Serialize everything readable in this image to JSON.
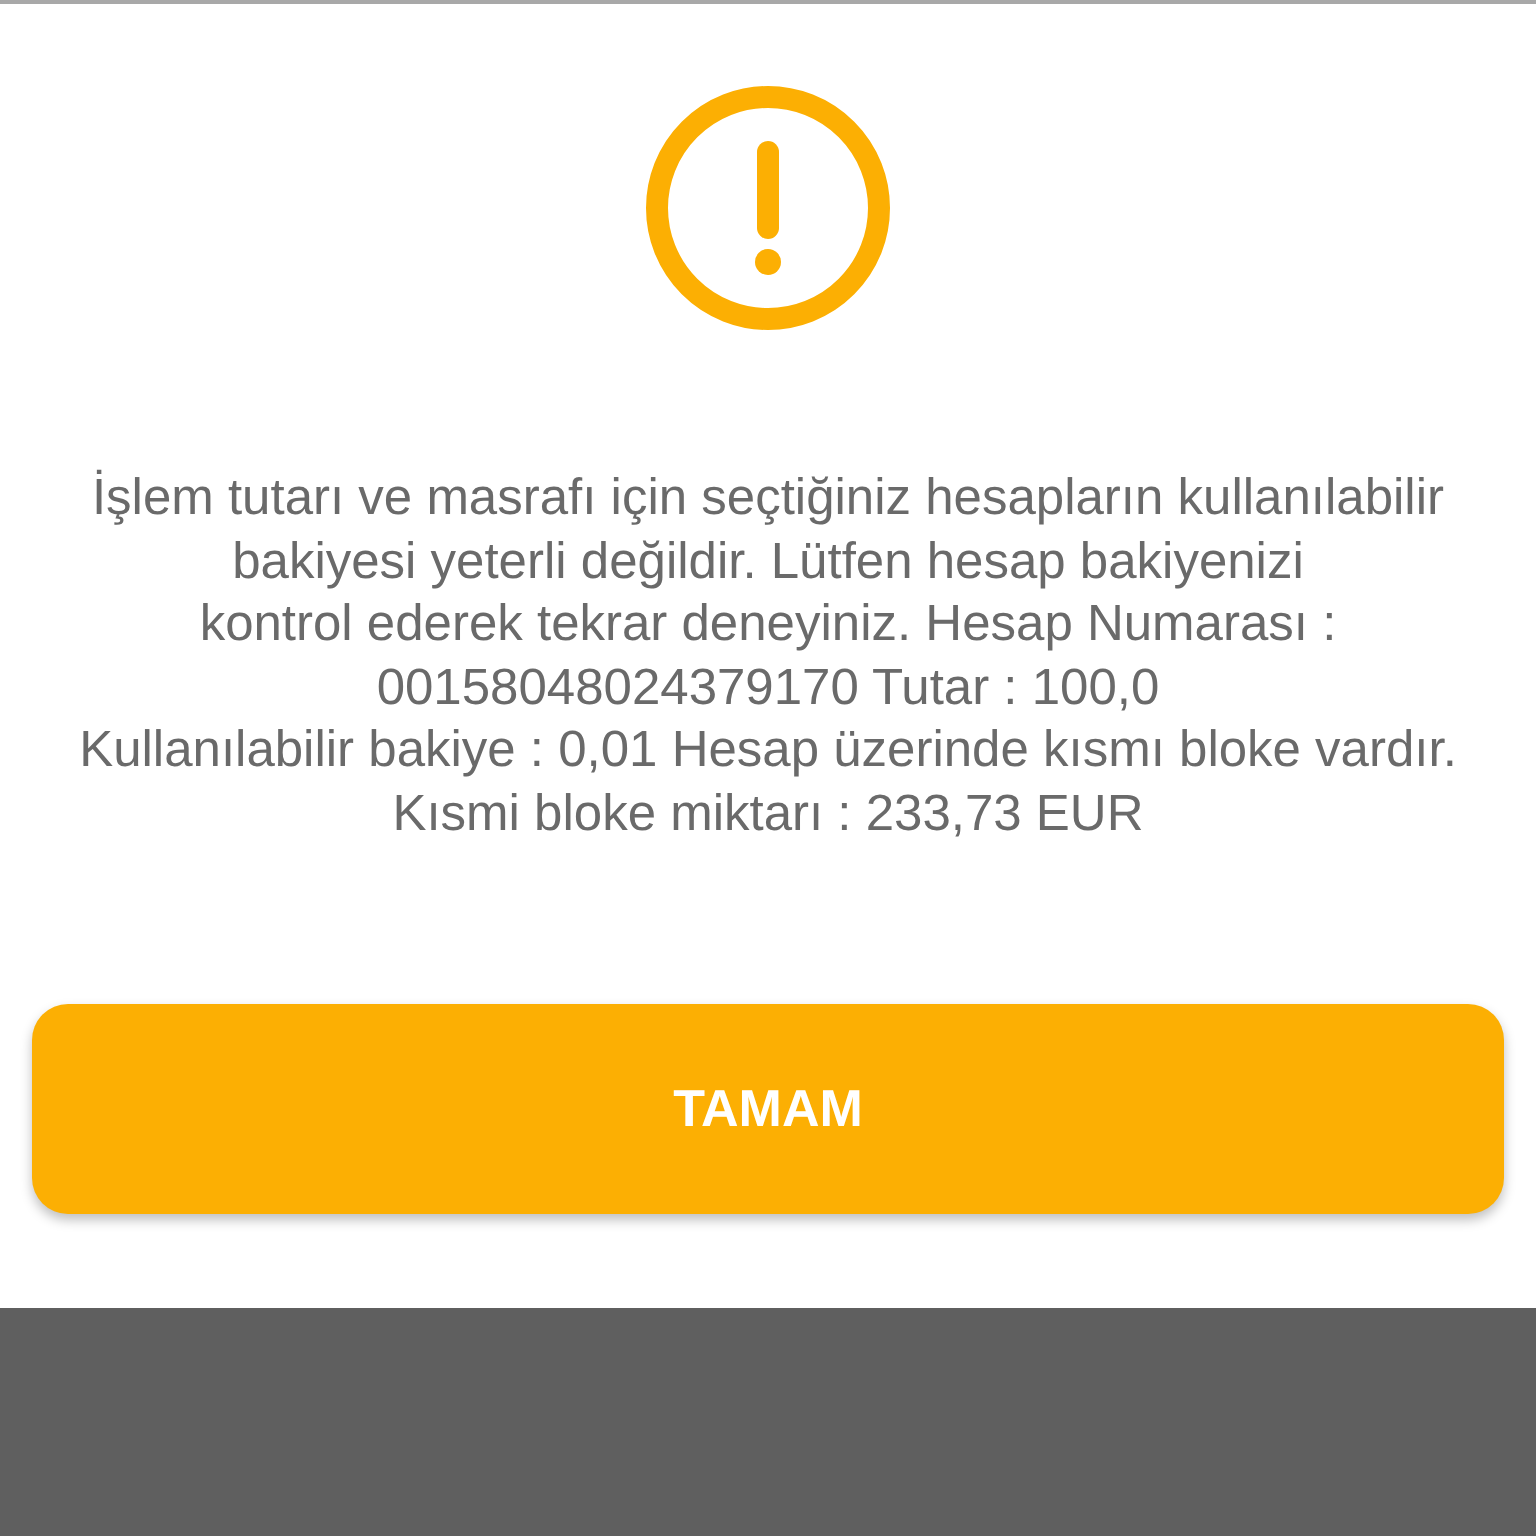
{
  "dialog": {
    "kind": "warning",
    "message": "İşlem tutarı ve masrafı için seçtiğiniz hesapların kullanılabilir\nbakiyesi yeterli değildir. Lütfen hesap bakiyenizi\nkontrol ederek tekrar deneyiniz. Hesap Numarası :\n00158048024379170 Tutar : 100,0\nKullanılabilir bakiye : 0,01 Hesap üzerinde kısmı bloke vardır.\nKısmi bloke miktarı : 233,73 EUR",
    "button": {
      "label": "TAMAM"
    }
  }
}
